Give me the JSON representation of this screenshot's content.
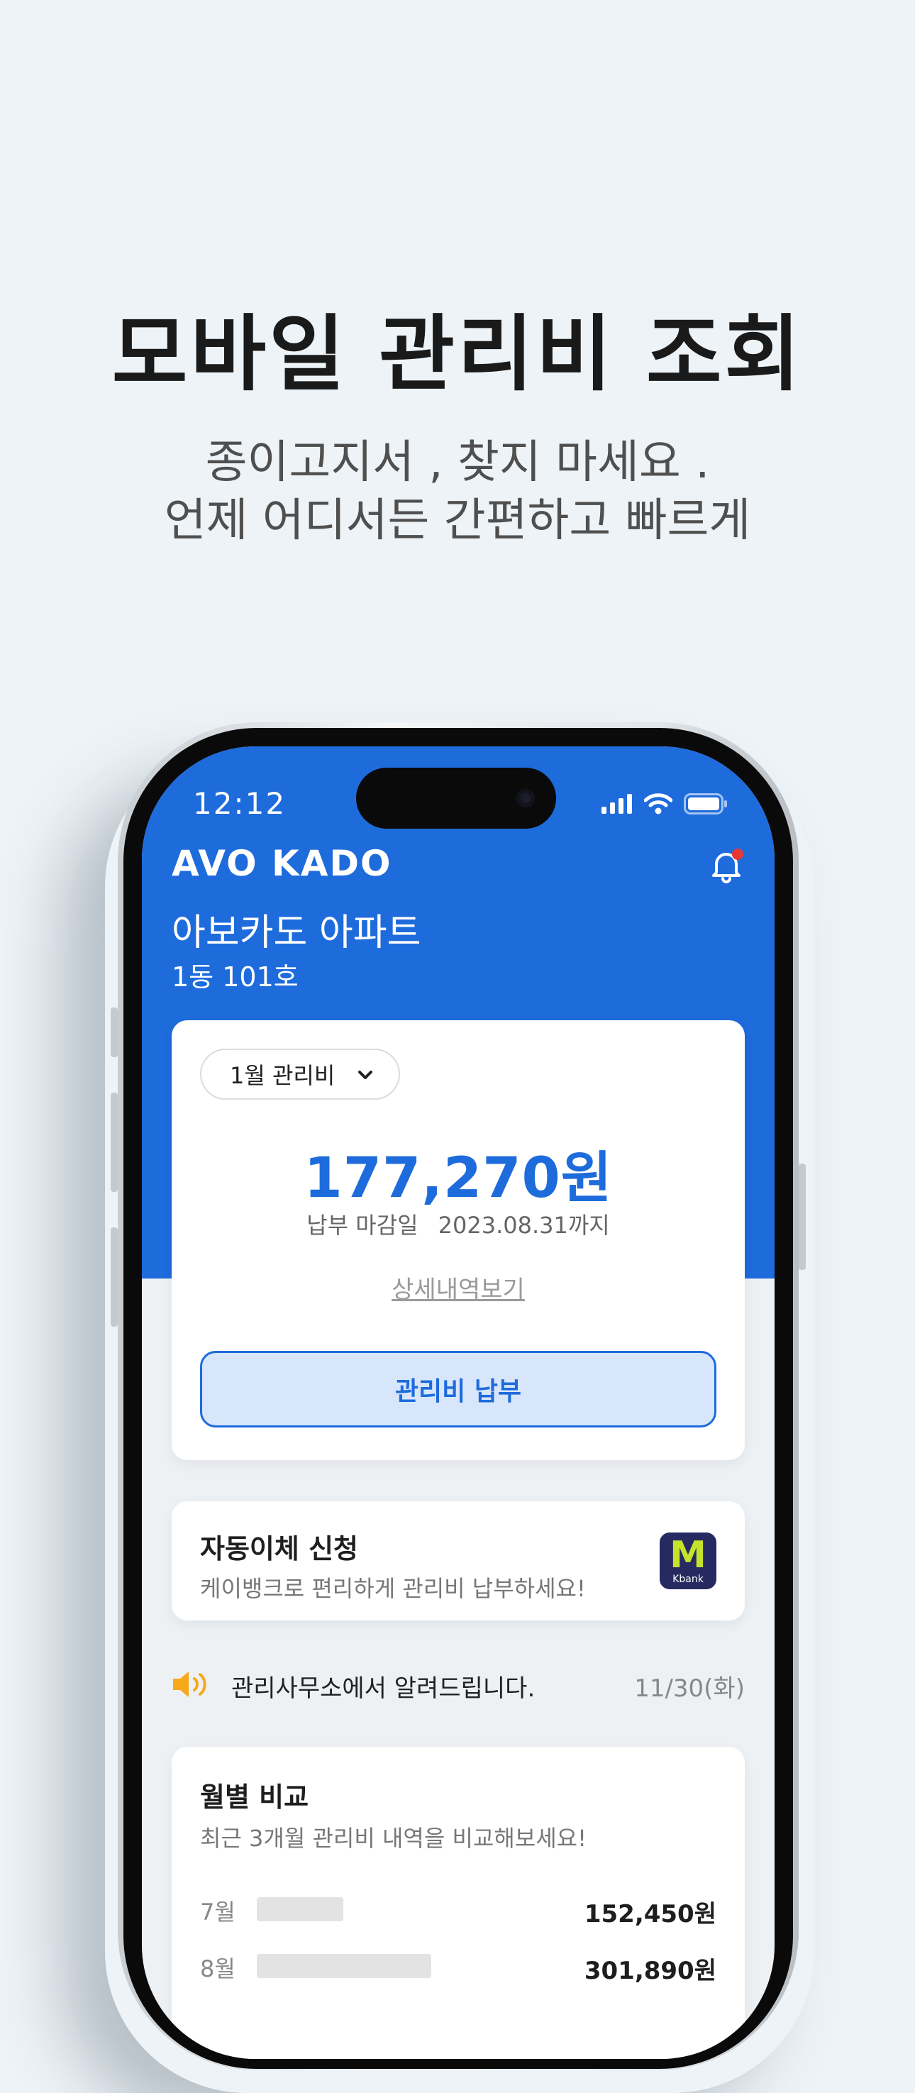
{
  "promo": {
    "headline": "모바일 관리비 조회",
    "subline1": "종이고지서 , 찾지 마세요 .",
    "subline2": "언제 어디서든 간편하고 빠르게"
  },
  "status_bar": {
    "time": "12:12"
  },
  "app": {
    "logo": "AVO KADO",
    "apartment_name": "아보카도 아파트",
    "unit": "1동 101호"
  },
  "bill": {
    "month_selector": "1월 관리비",
    "amount": "177,270원",
    "deadline_label": "납부 마감일",
    "deadline_date": "2023.08.31까지",
    "detail_link": "상세내역보기",
    "pay_button": "관리비 납부"
  },
  "auto_transfer": {
    "title": "자동이체 신청",
    "description": "케이뱅크로 편리하게 관리비 납부하세요!",
    "bank_logo_letter": "M",
    "bank_logo_text": "Kbank"
  },
  "notice": {
    "text": "관리사무소에서 알려드립니다.",
    "date": "11/30(화)"
  },
  "monthly_compare": {
    "title": "월별 비교",
    "description": "최근 3개월 관리비 내역을 비교해보세요!",
    "rows": [
      {
        "month": "7월",
        "amount": "152,450원"
      },
      {
        "month": "8월",
        "amount": "301,890원"
      }
    ]
  },
  "colors": {
    "brand_blue": "#1e6bdc",
    "kbank_navy": "#262a61",
    "kbank_green": "#c6e32c",
    "notification_dot": "#e53935"
  }
}
